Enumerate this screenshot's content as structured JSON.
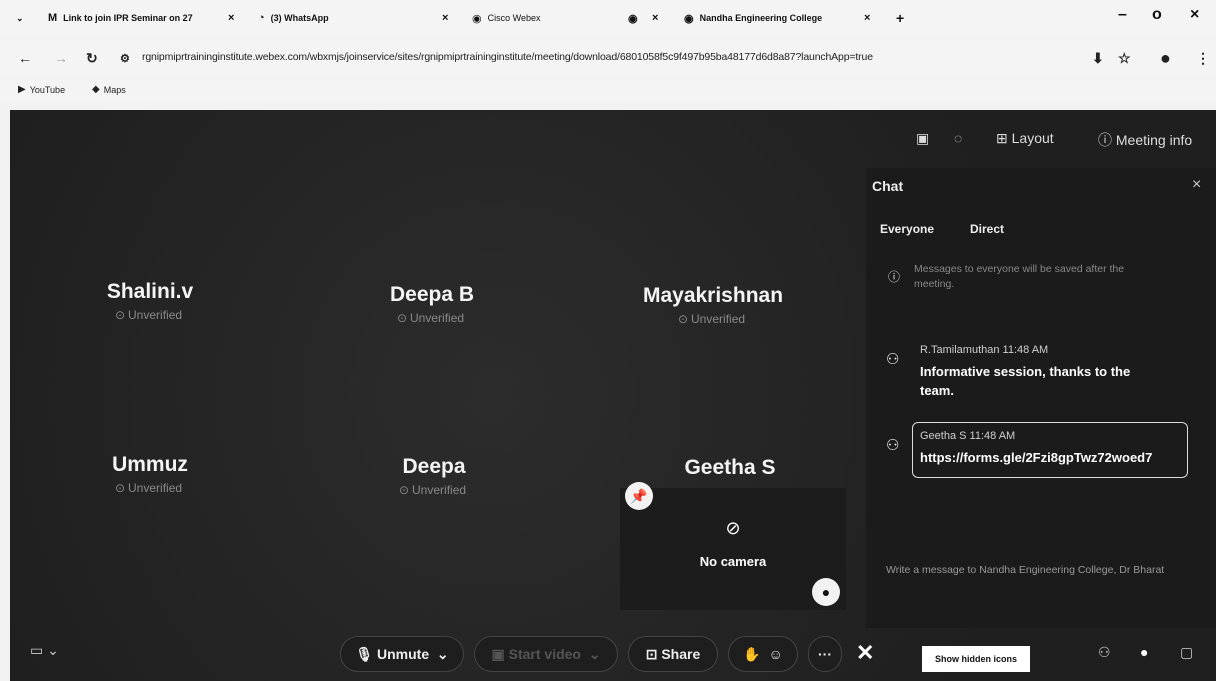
{
  "browser": {
    "tabs": [
      {
        "label": "Link to join IPR Seminar on 27",
        "icon": "gmail-icon"
      },
      {
        "label": "(3) WhatsApp",
        "icon": "whatsapp-icon"
      },
      {
        "label": "Cisco Webex",
        "icon": "webex-icon"
      },
      {
        "label": "",
        "icon": "webex-icon"
      },
      {
        "label": "Nandha Engineering College",
        "icon": "webex-icon"
      }
    ],
    "url": "rgnipmiprtraininginstitute.webex.com/wbxmjs/joinservice/sites/rgnipmiprtraininginstitute/meeting/download/6801058f5c9f497b95ba48177d6d8a87?launchApp=true",
    "bookmarks": [
      "YouTube",
      "Maps"
    ]
  },
  "meeting": {
    "layout_label": "Layout",
    "meeting_info_label": "Meeting info",
    "participants": [
      {
        "name": "Shalini.v",
        "status": "Unverified"
      },
      {
        "name": "Deepa B",
        "status": "Unverified"
      },
      {
        "name": "Mayakrishnan",
        "status": "Unverified"
      },
      {
        "name": "Ummuz",
        "status": "Unverified"
      },
      {
        "name": "Deepa",
        "status": "Unverified"
      },
      {
        "name": "Geetha S",
        "status": ""
      }
    ],
    "self_view": {
      "label": "No camera"
    }
  },
  "chat": {
    "title": "Chat",
    "tabs": [
      "Everyone",
      "Direct"
    ],
    "notice": "Messages to everyone will be saved after the meeting.",
    "messages": [
      {
        "sender": "R.Tamilamuthan",
        "time": "11:48 AM",
        "text": "Informative session, thanks to the team."
      },
      {
        "sender": "Geetha S",
        "time": "11:48 AM",
        "text": "https://forms.gle/2Fzi8gpTwz72woed7"
      }
    ],
    "input_placeholder": "Write a message to Nandha Engineering College, Dr Bharat"
  },
  "toolbar": {
    "unmute_label": "Unmute",
    "video_label": "Start video",
    "share_label": "Share",
    "show_hidden_label": "Show hidden icons"
  }
}
